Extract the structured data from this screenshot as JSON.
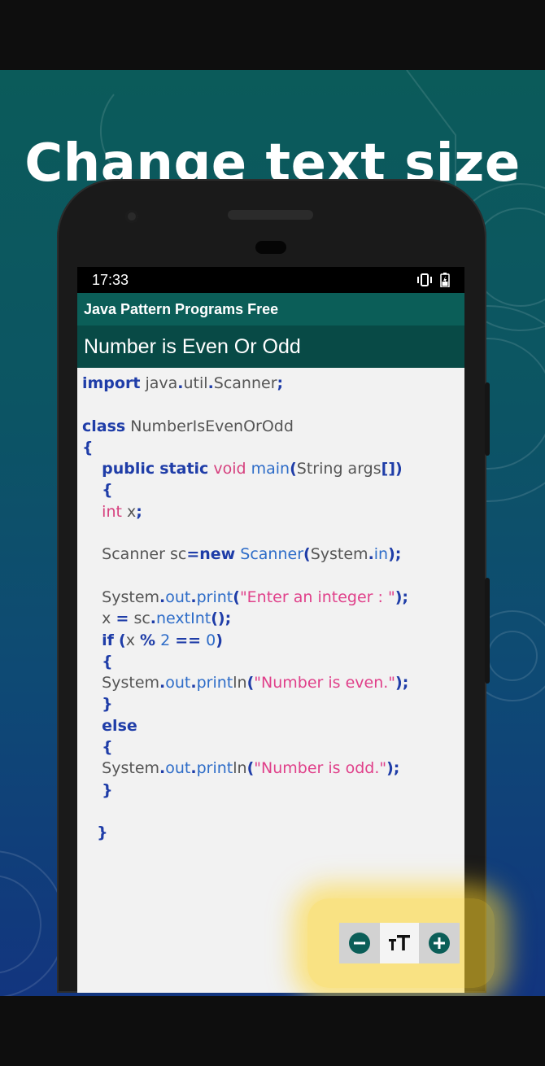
{
  "promo": {
    "headline": "Change text size"
  },
  "statusbar": {
    "time": "17:33"
  },
  "app": {
    "name": "Java Pattern Programs Free",
    "program_title": "Number is Even Or Odd"
  },
  "code": {
    "lines": [
      "import java.util.Scanner;",
      "",
      "class NumberIsEvenOrOdd",
      "{",
      "    public static void main(String args[])",
      "    {",
      "    int x;",
      "",
      "    Scanner sc=new Scanner(System.in);",
      "",
      "    System.out.print(\"Enter an integer : \");",
      "    x = sc.nextInt();",
      "    if (x % 2 == 0)",
      "    {",
      "    System.out.println(\"Number is even.\");",
      "    }",
      "    else",
      "    {",
      "    System.out.println(\"Number is odd.\");",
      "    }",
      "",
      "   }"
    ]
  },
  "text_size_controls": {
    "decrease_icon": "minus-circle-icon",
    "size_icon": "text-size-icon",
    "increase_icon": "plus-circle-icon",
    "button_color": "#0b5e58",
    "highlight_color": "#ffd628"
  },
  "colors": {
    "app_bar": "#0b5e58",
    "title_bar": "#084a46",
    "keyword": "#1f3da8",
    "type": "#d6407e",
    "string": "#e0408a"
  }
}
